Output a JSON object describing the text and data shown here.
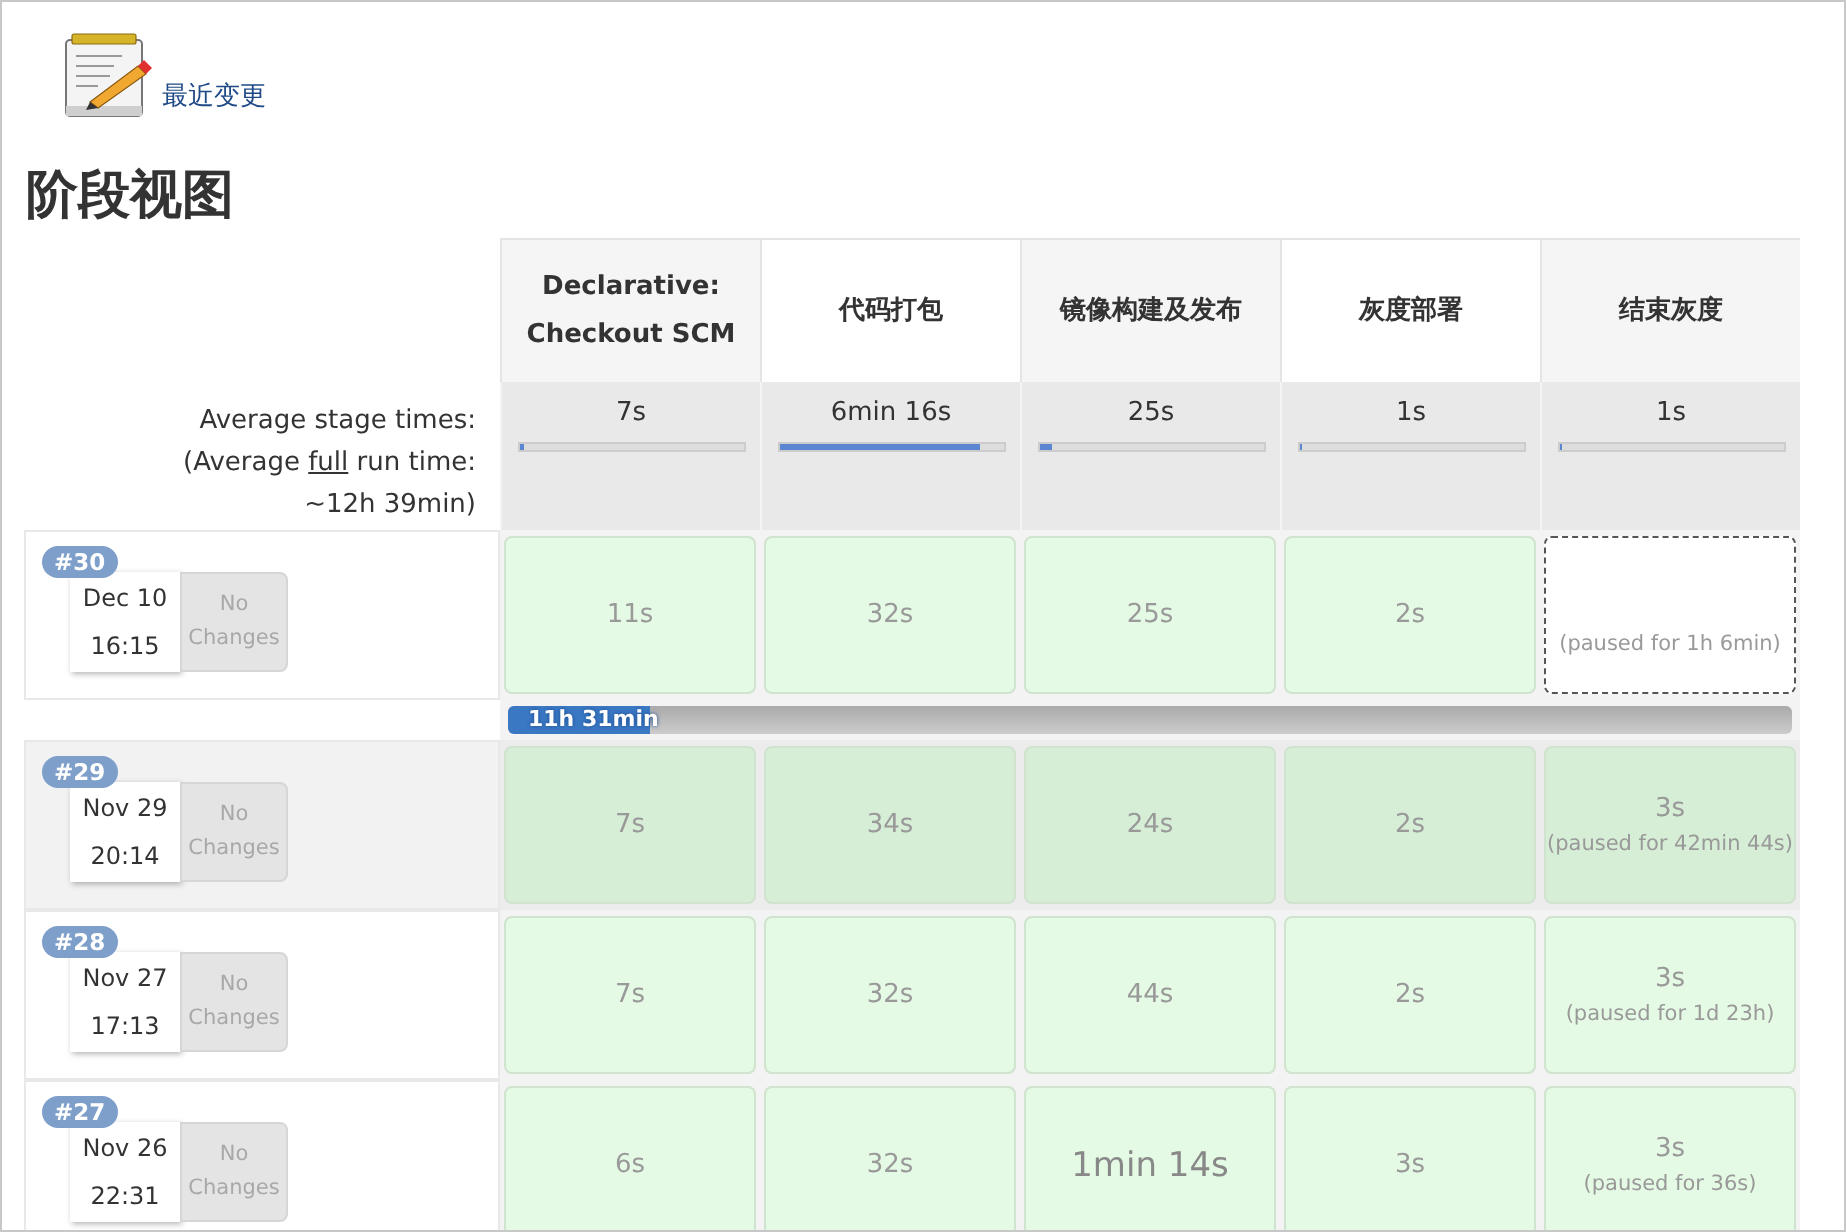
{
  "header": {
    "changes_link": "最近变更",
    "title": "阶段视图"
  },
  "stages": [
    {
      "name": "Declarative: Checkout SCM",
      "avg_time": "7s",
      "level": 0.02
    },
    {
      "name": "代码打包",
      "avg_time": "6min 16s",
      "level": 0.9
    },
    {
      "name": "镜像构建及发布",
      "avg_time": "25s",
      "level": 0.06
    },
    {
      "name": "灰度部署",
      "avg_time": "1s",
      "level": 0.01
    },
    {
      "name": "结束灰度",
      "avg_time": "1s",
      "level": 0.01
    }
  ],
  "averages": {
    "label": "Average stage times:",
    "full_prefix": "(Average ",
    "full_link": "full",
    "full_suffix": " run time: ~12h 39min)"
  },
  "runs": [
    {
      "number": "#30",
      "date": "Dec 10",
      "time": "16:15",
      "changes": "No Changes",
      "highlighted": false,
      "cells": [
        {
          "kind": "success",
          "time": "11s"
        },
        {
          "kind": "success",
          "time": "32s"
        },
        {
          "kind": "success",
          "time": "25s"
        },
        {
          "kind": "success",
          "time": "2s"
        },
        {
          "kind": "pending",
          "paused": "(paused for 1h 6min)"
        }
      ],
      "progress": {
        "label": "11h 31min",
        "level": 0.11
      }
    },
    {
      "number": "#29",
      "date": "Nov 29",
      "time": "20:14",
      "changes": "No Changes",
      "highlighted": true,
      "cells": [
        {
          "kind": "success",
          "time": "7s"
        },
        {
          "kind": "success",
          "time": "34s"
        },
        {
          "kind": "success",
          "time": "24s"
        },
        {
          "kind": "success",
          "time": "2s"
        },
        {
          "kind": "success",
          "time": "3s",
          "paused": "(paused for 42min 44s)"
        }
      ]
    },
    {
      "number": "#28",
      "date": "Nov 27",
      "time": "17:13",
      "changes": "No Changes",
      "highlighted": false,
      "cells": [
        {
          "kind": "success",
          "time": "7s"
        },
        {
          "kind": "success",
          "time": "32s"
        },
        {
          "kind": "success",
          "time": "44s"
        },
        {
          "kind": "success",
          "time": "2s"
        },
        {
          "kind": "success",
          "time": "3s",
          "paused": "(paused for 1d 23h)"
        }
      ]
    },
    {
      "number": "#27",
      "date": "Nov 26",
      "time": "22:31",
      "changes": "No Changes",
      "highlighted": false,
      "cells": [
        {
          "kind": "success",
          "time": "6s"
        },
        {
          "kind": "success",
          "time": "32s"
        },
        {
          "kind": "long",
          "time": "1min 14s"
        },
        {
          "kind": "success",
          "time": "3s"
        },
        {
          "kind": "success",
          "time": "3s",
          "paused": "(paused for 36s)"
        }
      ]
    }
  ]
}
